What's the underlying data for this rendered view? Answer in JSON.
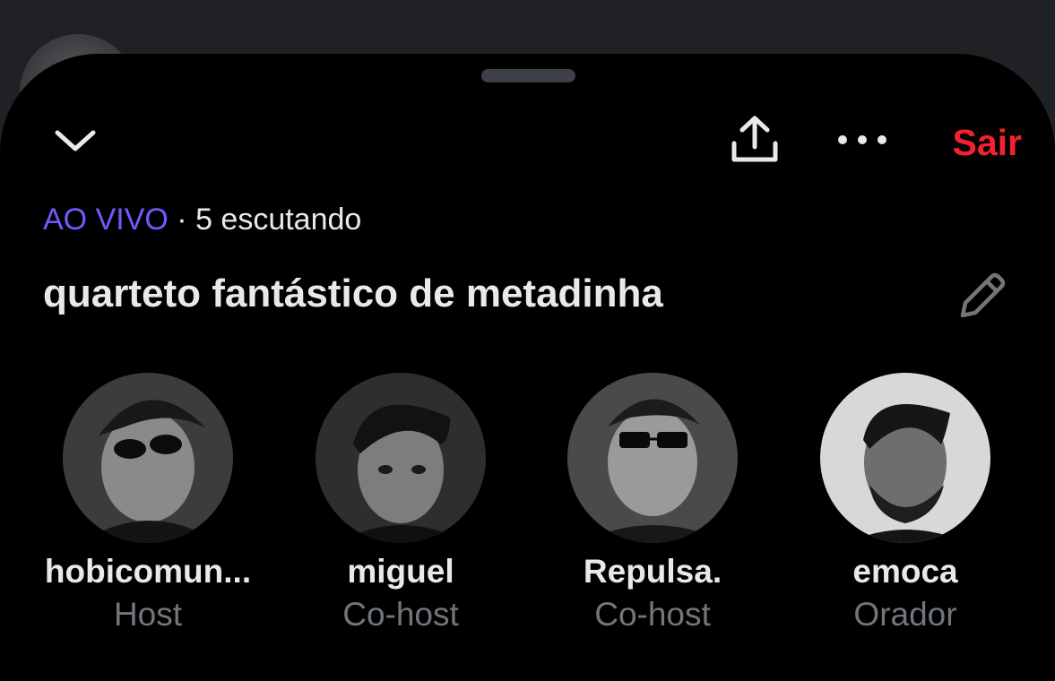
{
  "header": {
    "leave_label": "Sair",
    "leave_color": "#f4212e",
    "icons": {
      "collapse": "chevron-down-icon",
      "share": "share-icon",
      "more": "more-icon",
      "edit": "pencil-icon"
    }
  },
  "status": {
    "live_label": "AO VIVO",
    "separator": "·",
    "listeners": "5 escutando",
    "live_color": "#7856ff"
  },
  "space": {
    "title": "quarteto fantástico de metadinha"
  },
  "participants": [
    {
      "name": "hobicomun...",
      "role": "Host"
    },
    {
      "name": "miguel",
      "role": "Co-host"
    },
    {
      "name": "Repulsa.",
      "role": "Co-host"
    },
    {
      "name": "emoca",
      "role": "Orador"
    }
  ]
}
